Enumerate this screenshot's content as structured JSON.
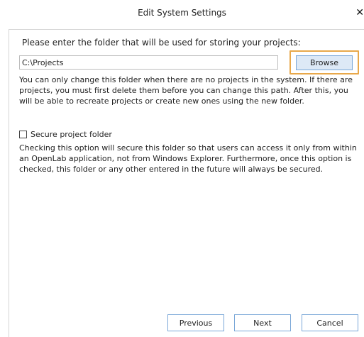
{
  "window": {
    "title": "Edit System Settings",
    "close_glyph": "✕"
  },
  "folder": {
    "prompt": "Please enter the folder that will be used for storing your projects:",
    "path_value": "C:\\Projects",
    "browse_label": "Browse",
    "note": "You can only change this folder when there are no projects in the system. If there are projects, you must first delete them before you can change this path. After this, you will be able to recreate projects or create new ones using the new folder."
  },
  "secure": {
    "checked": false,
    "label": "Secure project folder",
    "description": "Checking this option will secure this folder so that users can access it only from within an OpenLab application, not from Windows Explorer. Furthermore, once this option is checked, this folder or any other entered in the future will always be secured."
  },
  "footer": {
    "previous_label": "Previous",
    "next_label": "Next",
    "cancel_label": "Cancel"
  },
  "colors": {
    "highlight": "#e8a84a",
    "button_border": "#7aa7d8",
    "button_fill": "#dde9f6"
  },
  "icons": {
    "close": "close-icon"
  }
}
